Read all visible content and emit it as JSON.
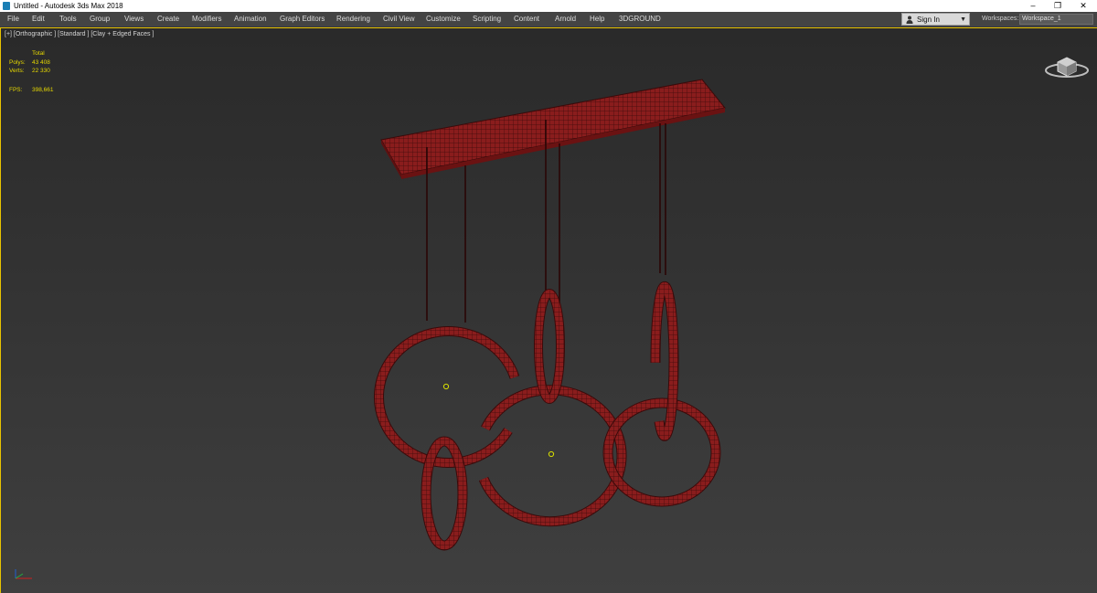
{
  "titlebar": {
    "title": "Untitled - Autodesk 3ds Max 2018",
    "minimize": "–",
    "restore": "❐",
    "close": "✕"
  },
  "menu": [
    "File",
    "Edit",
    "Tools",
    "Group",
    "Views",
    "Create",
    "Modifiers",
    "Animation",
    "Graph Editors",
    "Rendering",
    "Civil View",
    "Customize",
    "Scripting",
    "Content",
    "Arnold",
    "Help",
    "3DGROUND"
  ],
  "account": {
    "sign_in": "Sign In"
  },
  "workspaces": {
    "label": "Workspaces:",
    "value": "Workspace_1"
  },
  "viewport": {
    "label": "[+] [Orthographic ] [Standard ] [Clay + Edged Faces ]",
    "stats": {
      "total_label": "Total",
      "polys_label": "Polys:",
      "polys_value": "43 408",
      "verts_label": "Verts:",
      "verts_value": "22 330",
      "fps_label": "FPS:",
      "fps_value": "398,661"
    }
  },
  "colors": {
    "selection_border": "#e8c300",
    "model": "#8c1c1c",
    "stats_text": "#e6d800"
  },
  "icons": {
    "app": "3ds-max-icon",
    "user": "user-icon",
    "viewcube": "viewcube-icon",
    "axis": "axis-tripod-icon"
  }
}
